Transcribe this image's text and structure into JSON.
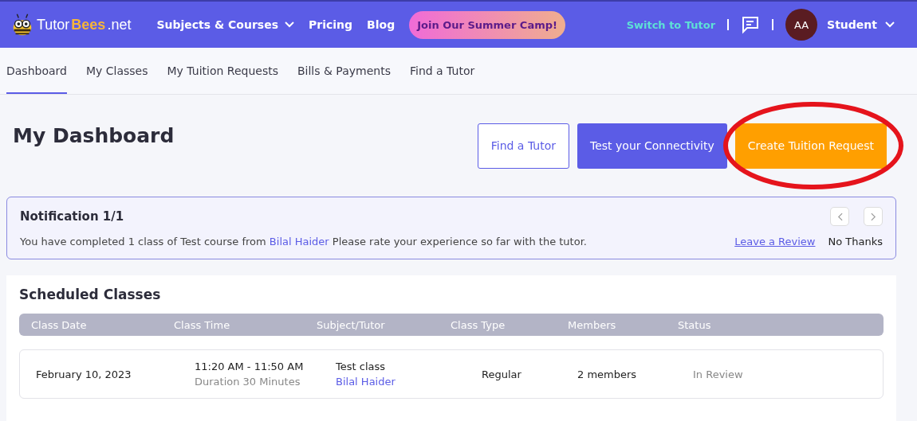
{
  "navbar": {
    "logo": {
      "part1": "Tutor",
      "part2": "Bees",
      "part3": ".net"
    },
    "links": [
      {
        "label": "Subjects & Courses",
        "dropdown": true
      },
      {
        "label": "Pricing",
        "dropdown": false
      },
      {
        "label": "Blog",
        "dropdown": false
      }
    ],
    "promo": "Join Our Summer Camp!",
    "switch_link": "Switch to Tutor",
    "avatar": "AA",
    "user": "Student"
  },
  "tabs": [
    {
      "label": "Dashboard",
      "selected": true
    },
    {
      "label": "My Classes",
      "selected": false
    },
    {
      "label": "My Tuition Requests",
      "selected": false
    },
    {
      "label": "Bills & Payments",
      "selected": false
    },
    {
      "label": "Find a Tutor",
      "selected": false
    }
  ],
  "title": "My Dashboard",
  "actions": [
    {
      "label": "Find a Tutor",
      "kind": "outline"
    },
    {
      "label": "Test your Connectivity",
      "kind": "primary"
    },
    {
      "label": "Create Tuition Request",
      "kind": "accent"
    }
  ],
  "notification": {
    "title": "Notification 1/1",
    "text_before": "You have completed 1 class of Test course from",
    "tutor": "Bilal Haider",
    "text_after": "Please rate your experience so far with the tutor.",
    "review_link": "Leave a Review",
    "dismiss": "No Thanks"
  },
  "scheduled": {
    "title": "Scheduled Classes",
    "columns": [
      "Class Date",
      "Class Time",
      "Subject/Tutor",
      "Class Type",
      "Members",
      "Status"
    ],
    "rows": [
      {
        "date": "February 10, 2023",
        "time": "11:20 AM - 11:50 AM",
        "duration": "Duration 30 Minutes",
        "subject": "Test class",
        "tutor": "Bilal Haider",
        "type": "Regular",
        "members": "2 members",
        "status": "In Review"
      }
    ]
  }
}
